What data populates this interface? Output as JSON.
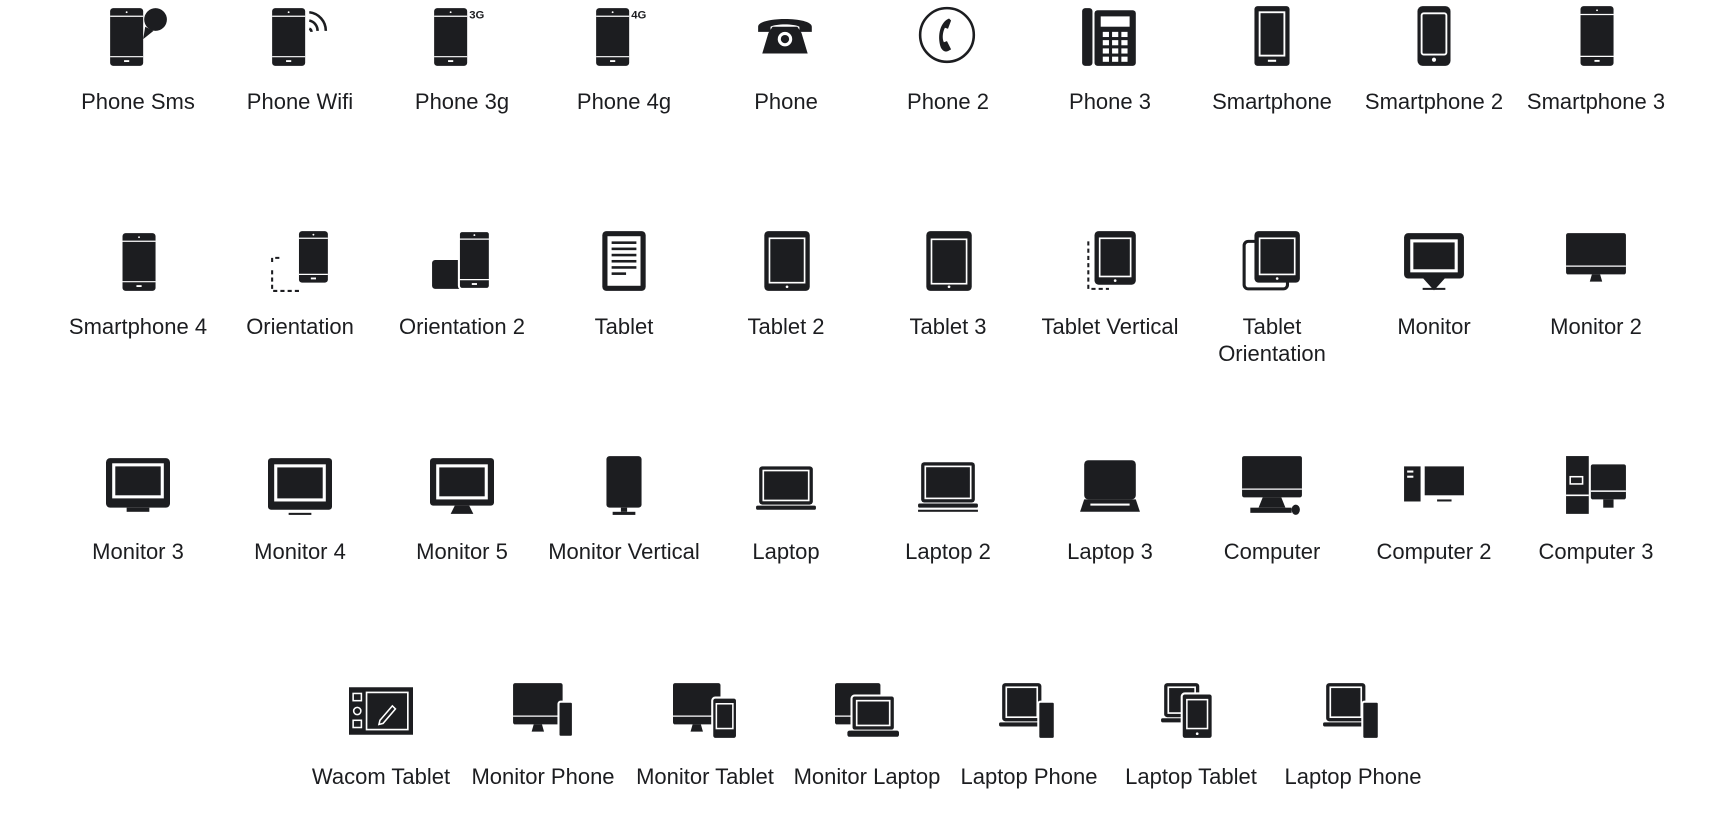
{
  "icon_color": "#1c1d20",
  "rows": [
    [
      {
        "label": "Phone Sms",
        "icon": "phone-sms-icon"
      },
      {
        "label": "Phone Wifi",
        "icon": "phone-wifi-icon"
      },
      {
        "label": "Phone 3g",
        "icon": "phone-3g-icon",
        "badge": "3G"
      },
      {
        "label": "Phone 4g",
        "icon": "phone-4g-icon",
        "badge": "4G"
      },
      {
        "label": "Phone",
        "icon": "phone-icon"
      },
      {
        "label": "Phone 2",
        "icon": "phone-2-icon"
      },
      {
        "label": "Phone 3",
        "icon": "phone-3-icon"
      },
      {
        "label": "Smartphone",
        "icon": "smartphone-icon"
      },
      {
        "label": "Smartphone 2",
        "icon": "smartphone-2-icon"
      },
      {
        "label": "Smartphone 3",
        "icon": "smartphone-3-icon"
      }
    ],
    [
      {
        "label": "Smartphone 4",
        "icon": "smartphone-4-icon"
      },
      {
        "label": "Orientation",
        "icon": "orientation-icon"
      },
      {
        "label": "Orientation 2",
        "icon": "orientation-2-icon"
      },
      {
        "label": "Tablet",
        "icon": "tablet-icon"
      },
      {
        "label": "Tablet 2",
        "icon": "tablet-2-icon"
      },
      {
        "label": "Tablet 3",
        "icon": "tablet-3-icon"
      },
      {
        "label": "Tablet Vertical",
        "icon": "tablet-vertical-icon"
      },
      {
        "label": "Tablet Orientation",
        "icon": "tablet-orientation-icon"
      },
      {
        "label": "Monitor",
        "icon": "monitor-icon"
      },
      {
        "label": "Monitor 2",
        "icon": "monitor-2-icon"
      }
    ],
    [
      {
        "label": "Monitor 3",
        "icon": "monitor-3-icon"
      },
      {
        "label": "Monitor 4",
        "icon": "monitor-4-icon"
      },
      {
        "label": "Monitor 5",
        "icon": "monitor-5-icon"
      },
      {
        "label": "Monitor Vertical",
        "icon": "monitor-vertical-icon"
      },
      {
        "label": "Laptop",
        "icon": "laptop-icon"
      },
      {
        "label": "Laptop 2",
        "icon": "laptop-2-icon"
      },
      {
        "label": "Laptop 3",
        "icon": "laptop-3-icon"
      },
      {
        "label": "Computer",
        "icon": "computer-icon"
      },
      {
        "label": "Computer 2",
        "icon": "computer-2-icon"
      },
      {
        "label": "Computer 3",
        "icon": "computer-3-icon"
      }
    ],
    [
      {
        "label": "Wacom Tablet",
        "icon": "wacom-tablet-icon"
      },
      {
        "label": "Monitor Phone",
        "icon": "monitor-phone-icon"
      },
      {
        "label": "Monitor Tablet",
        "icon": "monitor-tablet-icon"
      },
      {
        "label": "Monitor Laptop",
        "icon": "monitor-laptop-icon"
      },
      {
        "label": "Laptop Phone",
        "icon": "laptop-phone-icon"
      },
      {
        "label": "Laptop Tablet",
        "icon": "laptop-tablet-icon"
      },
      {
        "label": "Laptop Phone",
        "icon": "laptop-phone-icon"
      }
    ]
  ]
}
